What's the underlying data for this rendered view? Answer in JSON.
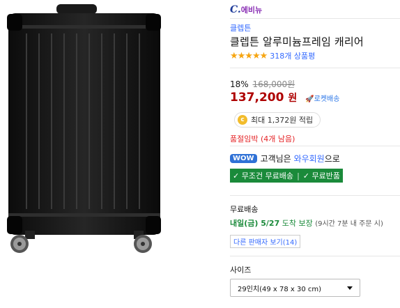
{
  "brand_logo": {
    "letter": "C.",
    "text": "에비뉴"
  },
  "product": {
    "brand": "클렙튼",
    "title": "클렙튼 알루미늄프레임 캐리어",
    "stars": "★★★★★",
    "rating": 4.5,
    "review_count": "318개 상품평"
  },
  "pricing": {
    "discount_rate": "18%",
    "original_price": "168,000원",
    "sale_price": "137,200",
    "sale_unit": "원",
    "rocket_label": "🚀로켓배송"
  },
  "reward": {
    "coin_symbol": "c",
    "text": "최대 1,372원 적립"
  },
  "stock_notice": "품절임박 (4개 남음)",
  "wow": {
    "badge": "WOW",
    "text_before": "고객님은",
    "member_link": "와우회원",
    "text_after": "으로",
    "benefit1": "✓ 무조건 무료배송",
    "benefit2": "✓ 무료반품"
  },
  "shipping": {
    "title": "무료배송",
    "date": "내일(금) 5/27",
    "arrival": "도착 보장",
    "condition": "(9시간 7분 내 주문 시)",
    "other_sellers": "다른 판매자 보기(14)"
  },
  "option": {
    "label": "사이즈",
    "selected": "29인치(49 x 78 x 30 cm)"
  },
  "colors": {
    "price_red": "#ae0000",
    "link_blue": "#346aff",
    "wow_green": "#1a8a3a"
  }
}
